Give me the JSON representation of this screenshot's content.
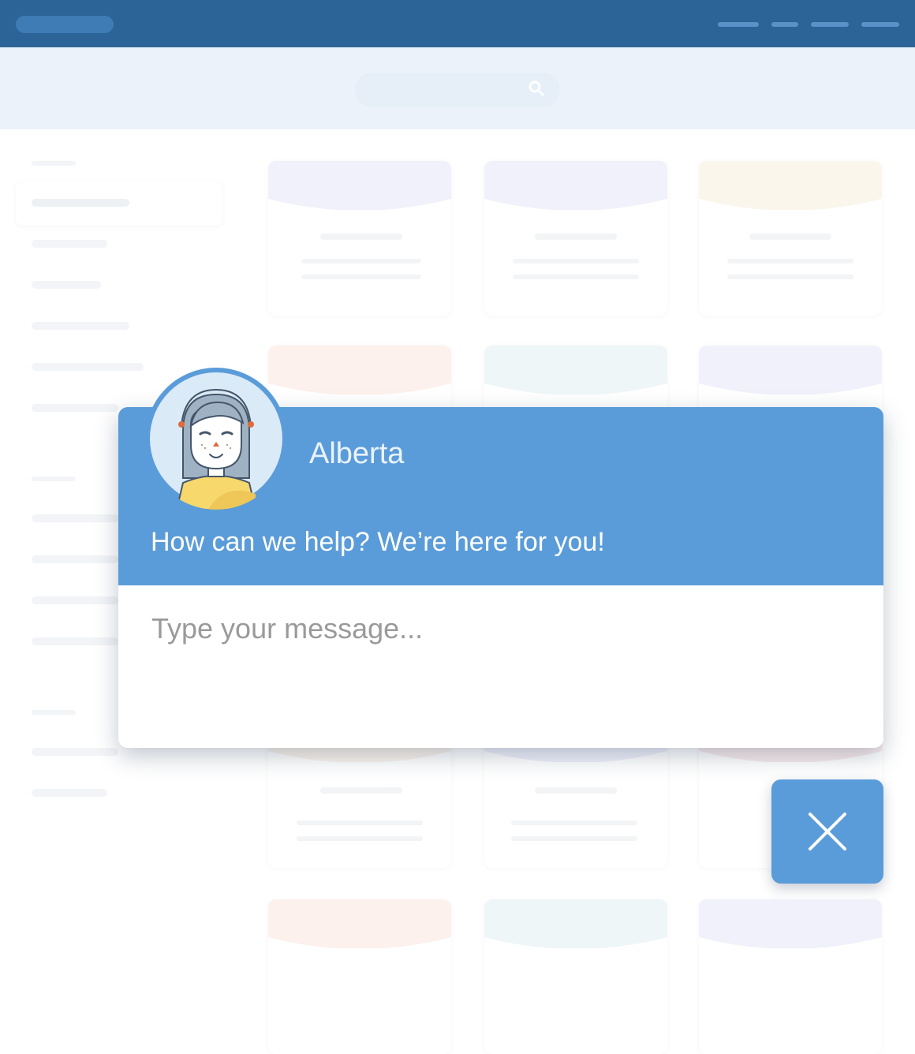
{
  "chat": {
    "agent_name": "Alberta",
    "greeting": "How can we help? We’re here for you!",
    "message_placeholder": "Type your message..."
  },
  "colors": {
    "header_bg": "#2c6498",
    "chat_accent": "#5a9cd9",
    "hero_bg": "#ebf2fa"
  },
  "icons": {
    "close": "close-icon",
    "search": "search-icon"
  }
}
